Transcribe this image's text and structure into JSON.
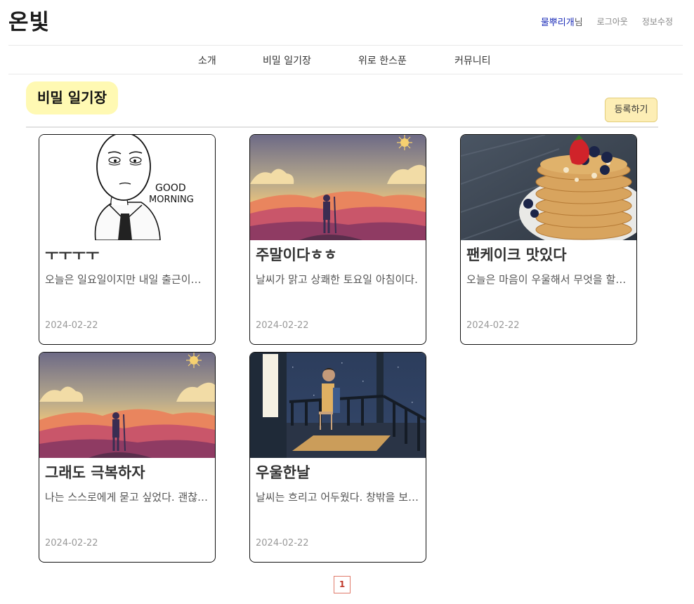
{
  "header": {
    "logo": "온빛",
    "user_name": "물뿌리개",
    "user_suffix": "님",
    "logout": "로그아웃",
    "edit_profile": "정보수정"
  },
  "nav": {
    "items": [
      {
        "label": "소개"
      },
      {
        "label": "비밀 일기장"
      },
      {
        "label": "위로 한스푼"
      },
      {
        "label": "커뮤니티"
      }
    ]
  },
  "page": {
    "title": "비밀 일기장",
    "register_button": "등록하기"
  },
  "posts": [
    {
      "title": "ㅜㅜㅜㅜ",
      "snippet": "오늘은 일요일이지만 내일 출근이라니...",
      "date": "2024-02-22",
      "image": "good-morning-sketch"
    },
    {
      "title": "주말이다ㅎㅎ",
      "snippet": "날씨가 맑고 상쾌한 토요일 아침이다.",
      "date": "2024-02-22",
      "image": "mountain-sunrise"
    },
    {
      "title": "팬케이크 맛있다",
      "snippet": "오늘은 마음이 우울해서 무엇을 할지...",
      "date": "2024-02-22",
      "image": "pancake-stack"
    },
    {
      "title": "그래도 극복하자",
      "snippet": "나는 스스로에게 묻고 싶었다. 괜찮니?",
      "date": "2024-02-22",
      "image": "mountain-sunrise"
    },
    {
      "title": "우울한날",
      "snippet": "날씨는 흐리고 어두웠다. 창밖을 보며...",
      "date": "2024-02-22",
      "image": "night-balcony"
    }
  ],
  "pagination": {
    "current": "1"
  },
  "colors": {
    "accent_title_bg": "#fff9b3",
    "register_bg": "#fdeeb5",
    "user_name": "#1a2bb8",
    "pager_border": "#e07a6a"
  }
}
